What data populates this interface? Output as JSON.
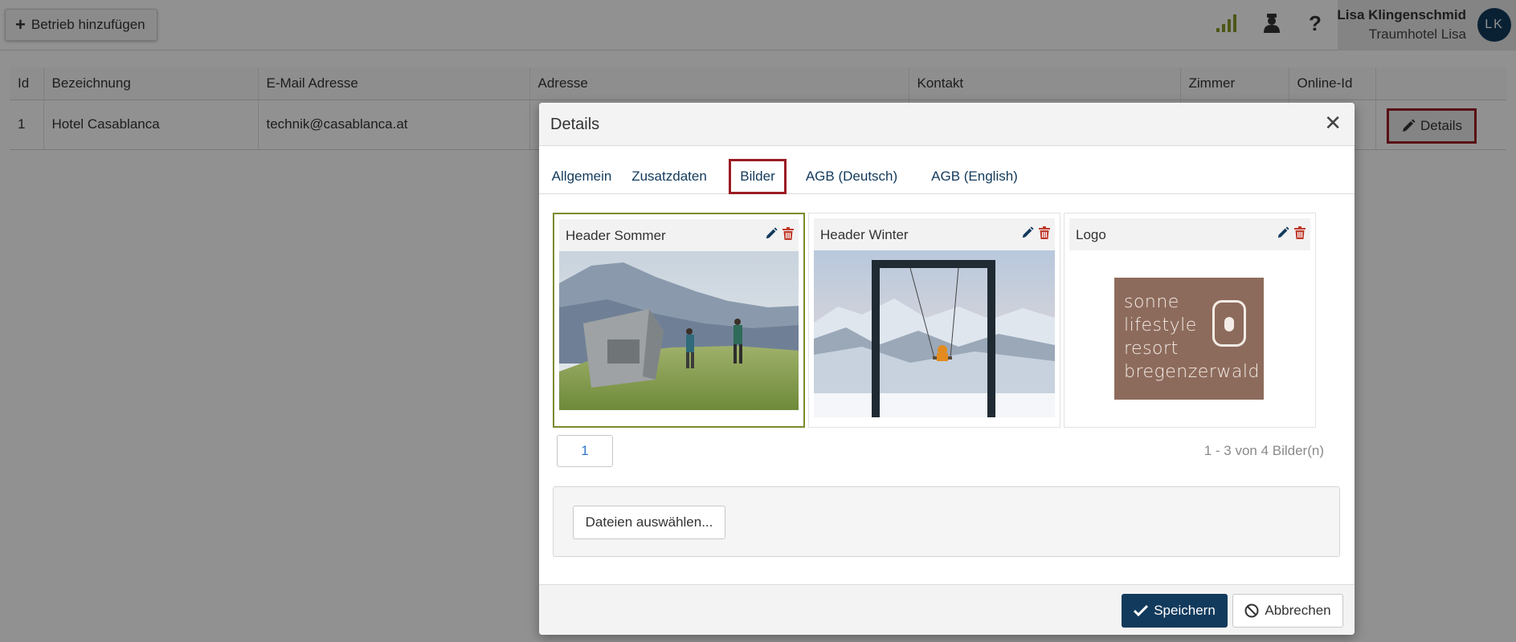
{
  "toolbar": {
    "add_label": "Betrieb hinzufügen"
  },
  "user": {
    "name": "Lisa Klingenschmid",
    "hotel": "Traumhotel Lisa",
    "initials": "LK"
  },
  "table": {
    "headers": [
      "Id",
      "Bezeichnung",
      "E-Mail Adresse",
      "Adresse",
      "Kontakt",
      "Zimmer",
      "Online-Id",
      ""
    ],
    "rows": [
      {
        "id": "1",
        "name": "Hotel Casablanca",
        "email": "technik@casablanca.at",
        "address": "",
        "contact": "",
        "rooms": "",
        "online_id": ""
      }
    ],
    "details_label": "Details"
  },
  "modal": {
    "title": "Details",
    "tabs": [
      "Allgemein",
      "Zusatzdaten",
      "Bilder",
      "AGB (Deutsch)",
      "AGB (English)"
    ],
    "active_tab": "Bilder",
    "images": [
      {
        "title": "Header Sommer",
        "icon": "mountain-summer-photo"
      },
      {
        "title": "Header Winter",
        "icon": "mountain-winter-swing-photo"
      },
      {
        "title": "Logo",
        "logo_text": [
          "sonne",
          "lifestyle",
          "resort",
          "bregenzerwald"
        ]
      }
    ],
    "pager": {
      "page": "1",
      "info": "1 - 3 von 4 Bilder(n)"
    },
    "upload_label": "Dateien auswählen...",
    "save_label": "Speichern",
    "cancel_label": "Abbrechen"
  },
  "colors": {
    "primary": "#123a5c",
    "highlight": "#9b1c24",
    "delete": "#c0392b",
    "selected_border": "#7c8a2c"
  }
}
